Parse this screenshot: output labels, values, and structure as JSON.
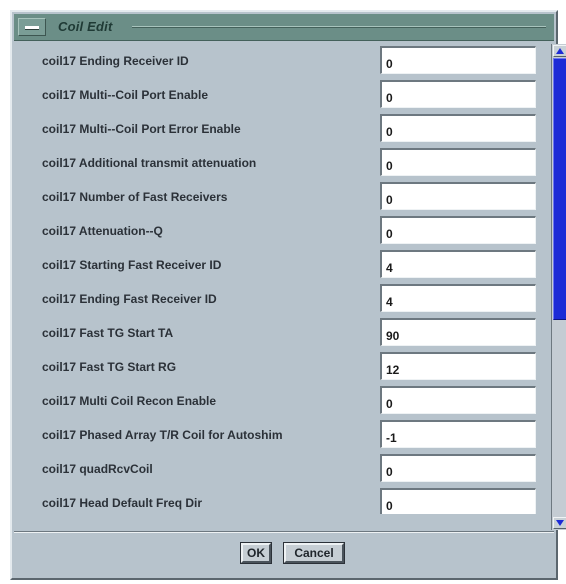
{
  "window": {
    "title": "Coil Edit"
  },
  "rows": [
    {
      "label": "coil17 Ending Receiver ID",
      "value": "0"
    },
    {
      "label": "coil17 Multi--Coil Port Enable",
      "value": "0"
    },
    {
      "label": "coil17 Multi--Coil Port Error Enable",
      "value": "0"
    },
    {
      "label": "coil17 Additional transmit attenuation",
      "value": "0"
    },
    {
      "label": "coil17 Number of Fast Receivers",
      "value": "0"
    },
    {
      "label": "coil17 Attenuation--Q",
      "value": "0"
    },
    {
      "label": "coil17 Starting Fast Receiver ID",
      "value": "4"
    },
    {
      "label": "coil17 Ending Fast Receiver ID",
      "value": "4"
    },
    {
      "label": "coil17 Fast TG Start TA",
      "value": "90"
    },
    {
      "label": "coil17 Fast TG Start RG",
      "value": "12"
    },
    {
      "label": "coil17 Multi Coil Recon Enable",
      "value": "0"
    },
    {
      "label": "coil17 Phased Array T/R Coil for Autoshim",
      "value": "-1"
    },
    {
      "label": "coil17 quadRcvCoil",
      "value": "0"
    },
    {
      "label": "coil17 Head Default Freq Dir",
      "value": "0"
    }
  ],
  "buttons": {
    "ok_label": "OK",
    "cancel_label": "Cancel"
  },
  "colors": {
    "titlebar": "#6b8e87",
    "panel": "#b7c3cc",
    "scroll_thumb": "#1c2ad6"
  },
  "icons": {
    "window_menu": "window-menu-icon",
    "scroll_up": "scroll-up-arrow-icon",
    "scroll_down": "scroll-down-arrow-icon"
  }
}
